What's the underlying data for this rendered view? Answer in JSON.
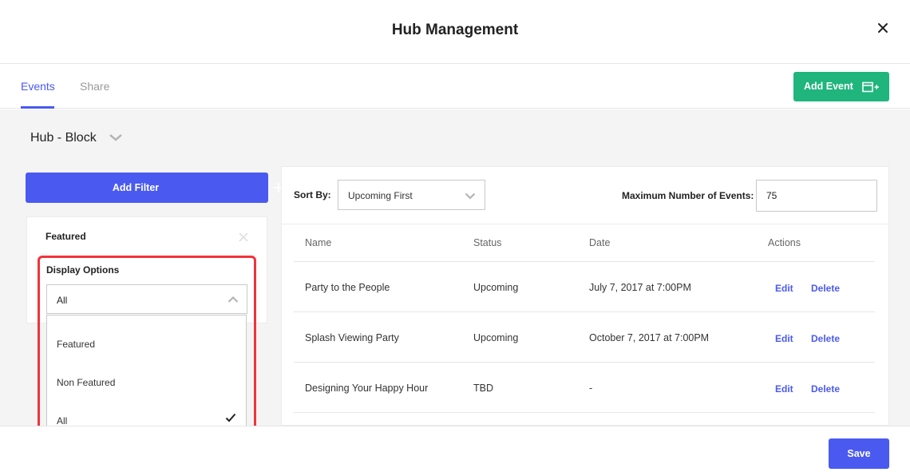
{
  "modal": {
    "title": "Hub Management"
  },
  "tabs": [
    {
      "label": "Events",
      "active": true
    },
    {
      "label": "Share",
      "active": false
    }
  ],
  "toolbar": {
    "add_event_label": "Add Event",
    "add_event_icon": "calendar-plus-icon"
  },
  "hub": {
    "name": "Hub - Block"
  },
  "filters": {
    "add_filter_label": "Add Filter",
    "active_filter": {
      "name": "Featured",
      "display_options_label": "Display Options",
      "selected": "All",
      "options": [
        {
          "label": "Featured",
          "selected": false
        },
        {
          "label": "Non Featured",
          "selected": false
        },
        {
          "label": "All",
          "selected": true
        }
      ]
    }
  },
  "events": {
    "sort_label": "Sort By:",
    "sort_value": "Upcoming First",
    "max_label": "Maximum Number of Events:",
    "max_value": "75",
    "columns": [
      "Name",
      "Status",
      "Date",
      "Actions"
    ],
    "rows": [
      {
        "name": "Party to the People",
        "status": "Upcoming",
        "date": "July 7, 2017 at 7:00PM",
        "edit": "Edit",
        "delete": "Delete"
      },
      {
        "name": "Splash Viewing Party",
        "status": "Upcoming",
        "date": "October 7, 2017 at 7:00PM",
        "edit": "Edit",
        "delete": "Delete"
      },
      {
        "name": "Designing Your Happy Hour",
        "status": "TBD",
        "date": "-",
        "edit": "Edit",
        "delete": "Delete"
      }
    ]
  },
  "footer": {
    "save_label": "Save"
  },
  "colors": {
    "primary": "#4a5af0",
    "success": "#1fb57d",
    "highlight": "#f0333a"
  }
}
